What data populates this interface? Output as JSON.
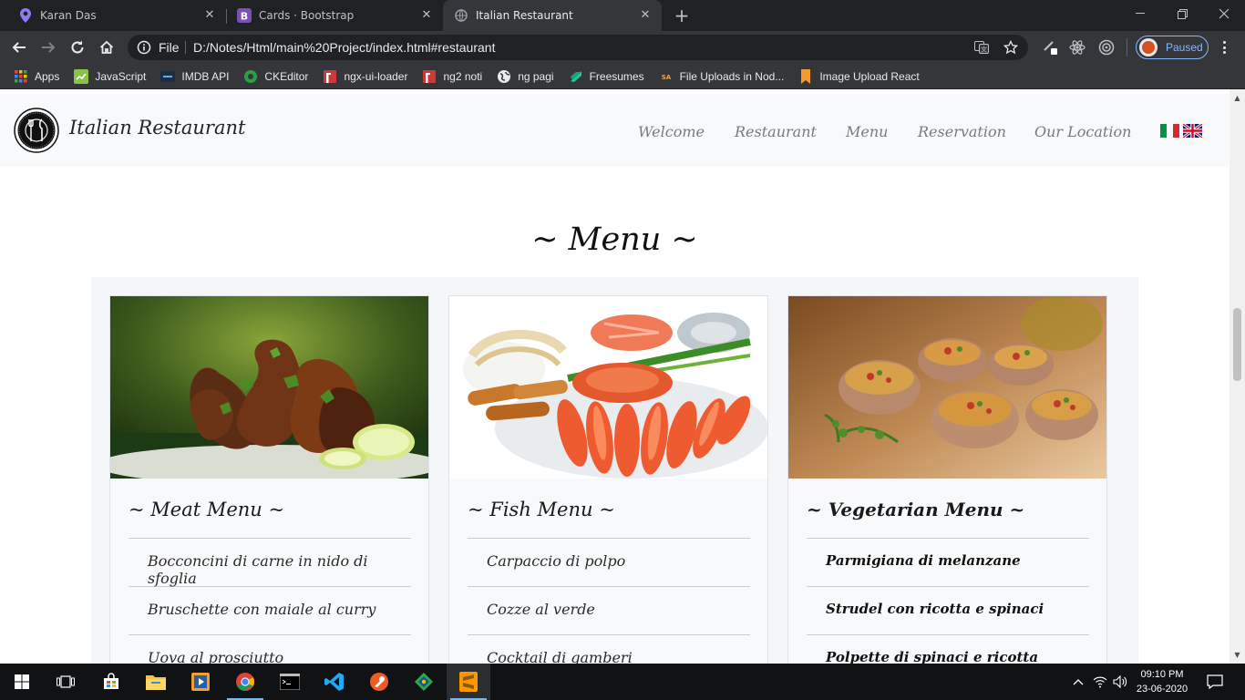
{
  "browser": {
    "tabs": [
      {
        "title": "Karan Das",
        "icon": "map-pin-icon",
        "active": false
      },
      {
        "title": "Cards · Bootstrap",
        "icon": "bootstrap-icon",
        "active": false
      },
      {
        "title": "Italian Restaurant",
        "icon": "globe-icon",
        "active": true
      }
    ],
    "omnibox": {
      "scheme_label": "File",
      "url": "D:/Notes/Html/main%20Project/index.html#restaurant"
    },
    "profile_status": "Paused",
    "bookmarks": [
      {
        "label": "Apps",
        "icon": "apps-grid-icon"
      },
      {
        "label": "JavaScript",
        "icon": "javascript-icon"
      },
      {
        "label": "IMDB API",
        "icon": "imdb-icon"
      },
      {
        "label": "CKEditor",
        "icon": "ckeditor-icon"
      },
      {
        "label": "ngx-ui-loader",
        "icon": "npm-icon"
      },
      {
        "label": "ng2 noti",
        "icon": "npm-icon"
      },
      {
        "label": "ng pagi",
        "icon": "globe-icon"
      },
      {
        "label": "Freesumes",
        "icon": "freesumes-icon"
      },
      {
        "label": "File Uploads in Nod...",
        "icon": "sa-icon"
      },
      {
        "label": "Image Upload React",
        "icon": "bookmark-icon"
      }
    ]
  },
  "site": {
    "brand": "Italian Restaurant",
    "nav": [
      "Welcome",
      "Restaurant",
      "Menu",
      "Reservation",
      "Our Location"
    ],
    "languages": [
      "italian-flag-icon",
      "uk-flag-icon"
    ],
    "section_title": "~ Menu ~",
    "cards": [
      {
        "title": "~ Meat Menu ~",
        "image": "grilled-chicken-image",
        "items": [
          "Bocconcini di carne in nido di sfoglia",
          "Bruschette con maiale al curry",
          "Uova al prosciutto"
        ]
      },
      {
        "title": "~ Fish Menu ~",
        "image": "seafood-platter-image",
        "items": [
          "Carpaccio di polpo",
          "Cozze al verde",
          "Cocktail di gamberi"
        ]
      },
      {
        "title": "~ Vegetarian Menu ~",
        "image": "stuffed-mushrooms-image",
        "items": [
          "Parmigiana di melanzane",
          "Strudel con ricotta e spinaci",
          "Polpette di spinaci e ricotta"
        ]
      }
    ]
  },
  "taskbar": {
    "time": "09:10 PM",
    "date": "23-06-2020"
  },
  "colors": {
    "chrome_dark": "#202124",
    "chrome_toolbar": "#35363a",
    "navbar_bg": "#f8f9fa",
    "nav_link": "#7a7a7a",
    "profile_accent": "#8ab4f8"
  }
}
